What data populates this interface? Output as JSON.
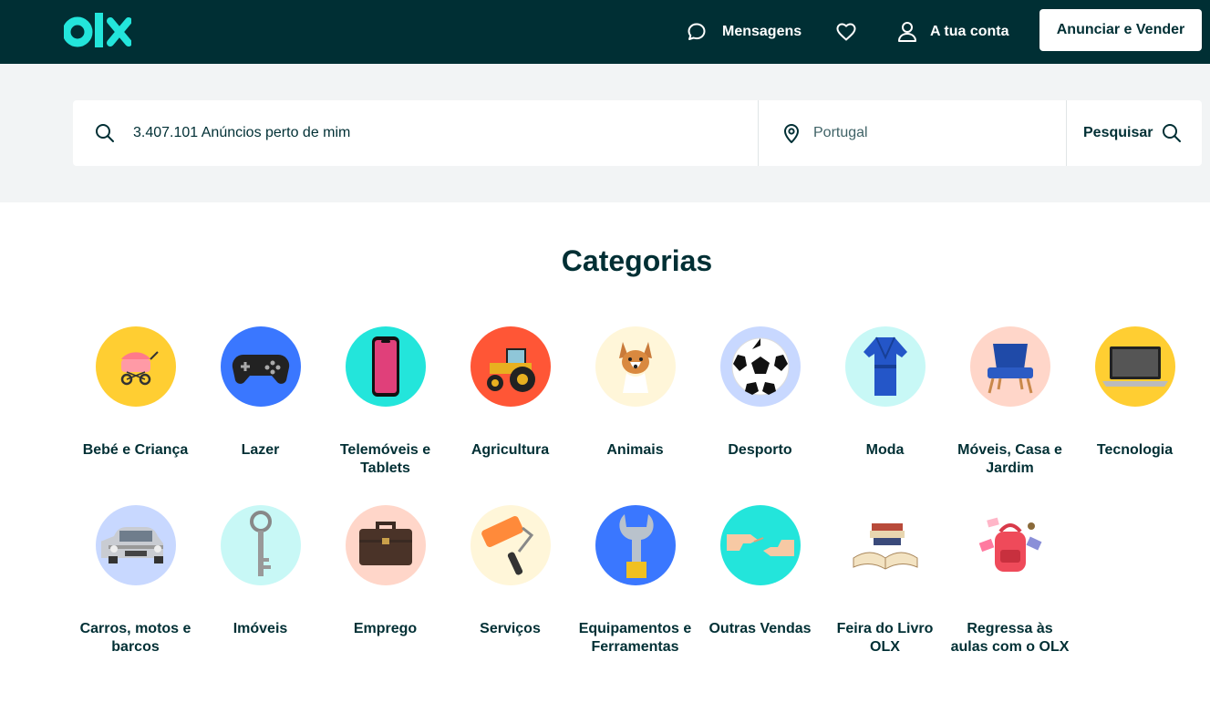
{
  "header": {
    "logo_text": "olx",
    "messages_label": "Mensagens",
    "account_label": "A tua conta",
    "sell_button_label": "Anunciar e Vender"
  },
  "search": {
    "query_text": "3.407.101 Anúncios perto de mim",
    "location_text": "Portugal",
    "button_label": "Pesquisar"
  },
  "categories": {
    "title": "Categorias",
    "items": [
      {
        "label": "Bebé e Criança",
        "color": "#ffce32",
        "icon": "stroller-icon"
      },
      {
        "label": "Lazer",
        "color": "#3a77ff",
        "icon": "gamepad-icon"
      },
      {
        "label": "Telemóveis e Tablets",
        "color": "#23e5db",
        "icon": "smartphone-icon"
      },
      {
        "label": "Agricultura",
        "color": "#ff5636",
        "icon": "tractor-icon"
      },
      {
        "label": "Animais",
        "color": "#fff6d9",
        "icon": "dog-icon"
      },
      {
        "label": "Desporto",
        "color": "#c8d8ff",
        "icon": "soccer-ball-icon"
      },
      {
        "label": "Moda",
        "color": "#c8f8f6",
        "icon": "robe-icon"
      },
      {
        "label": "Móveis, Casa e Jardim",
        "color": "#ffd6c9",
        "icon": "armchair-icon"
      },
      {
        "label": "Tecnologia",
        "color": "#ffce32",
        "icon": "laptop-icon"
      },
      {
        "label": "Carros, motos e barcos",
        "color": "#c8d8ff",
        "icon": "car-icon"
      },
      {
        "label": "Imóveis",
        "color": "#c8f8f6",
        "icon": "key-icon"
      },
      {
        "label": "Emprego",
        "color": "#ffd6c9",
        "icon": "briefcase-icon"
      },
      {
        "label": "Serviços",
        "color": "#fff6d9",
        "icon": "paint-roller-icon"
      },
      {
        "label": "Equipamentos e Ferramentas",
        "color": "#3a77ff",
        "icon": "wrench-icon"
      },
      {
        "label": "Outras Vendas",
        "color": "#23e5db",
        "icon": "hands-icon"
      },
      {
        "label": "Feira do Livro OLX",
        "color": "#ffffff",
        "icon": "books-icon"
      },
      {
        "label": "Regressa às aulas com o OLX",
        "color": "#ffffff",
        "icon": "school-bag-icon"
      }
    ]
  }
}
